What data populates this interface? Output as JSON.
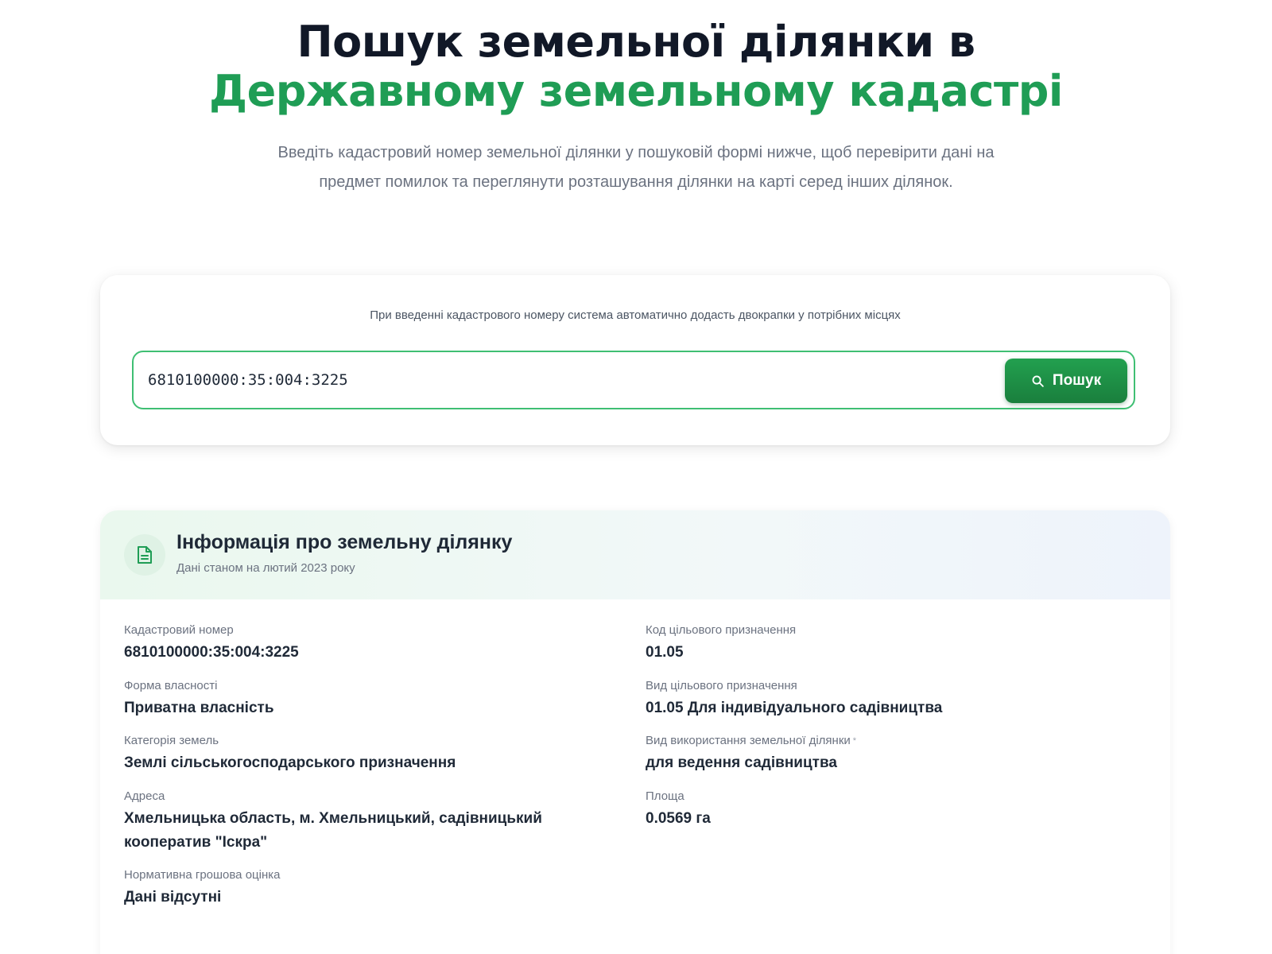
{
  "hero": {
    "title_line1": "Пошук земельної ділянки в",
    "title_line2": "Державному земельному кадастрі",
    "lead": "Введіть кадастровий номер земельної ділянки у пошуковій формі нижче, щоб перевірити дані на предмет помилок та переглянути розташування ділянки на карті серед інших ділянок."
  },
  "search": {
    "hint": "При введенні кадастрового номеру система автоматично додасть двокрапки у потрібних місцях",
    "value": "6810100000:35:004:3225",
    "button_label": "Пошук",
    "button_icon": "search-icon"
  },
  "info": {
    "icon": "document-icon",
    "title": "Інформація про земельну ділянку",
    "subtitle": "Дані станом на лютий 2023 року",
    "left_fields": [
      {
        "label": "Кадастровий номер",
        "value": "6810100000:35:004:3225"
      },
      {
        "label": "Форма власності",
        "value": "Приватна власність"
      },
      {
        "label": "Категорія земель",
        "value": "Землі сільськогосподарського призначення"
      },
      {
        "label": "Адреса",
        "value": "Хмельницька область, м. Хмельницький, садівницький кооператив \"Іскра\""
      },
      {
        "label": "Нормативна грошова оцінка",
        "value": "Дані відсутні"
      }
    ],
    "right_fields": [
      {
        "label": "Код цільового призначення",
        "value": "01.05"
      },
      {
        "label": "Вид цільового призначення",
        "value": "01.05 Для індивідуального садівництва"
      },
      {
        "label": "Вид використання земельної ділянки",
        "marker": "*",
        "value": "для ведення садівництва"
      },
      {
        "label": "Площа",
        "value": "0.0569 га"
      }
    ]
  },
  "colors": {
    "accent_green": "#1f9d55",
    "button_green": "#1a7f3d",
    "input_border": "#3fbf73"
  }
}
